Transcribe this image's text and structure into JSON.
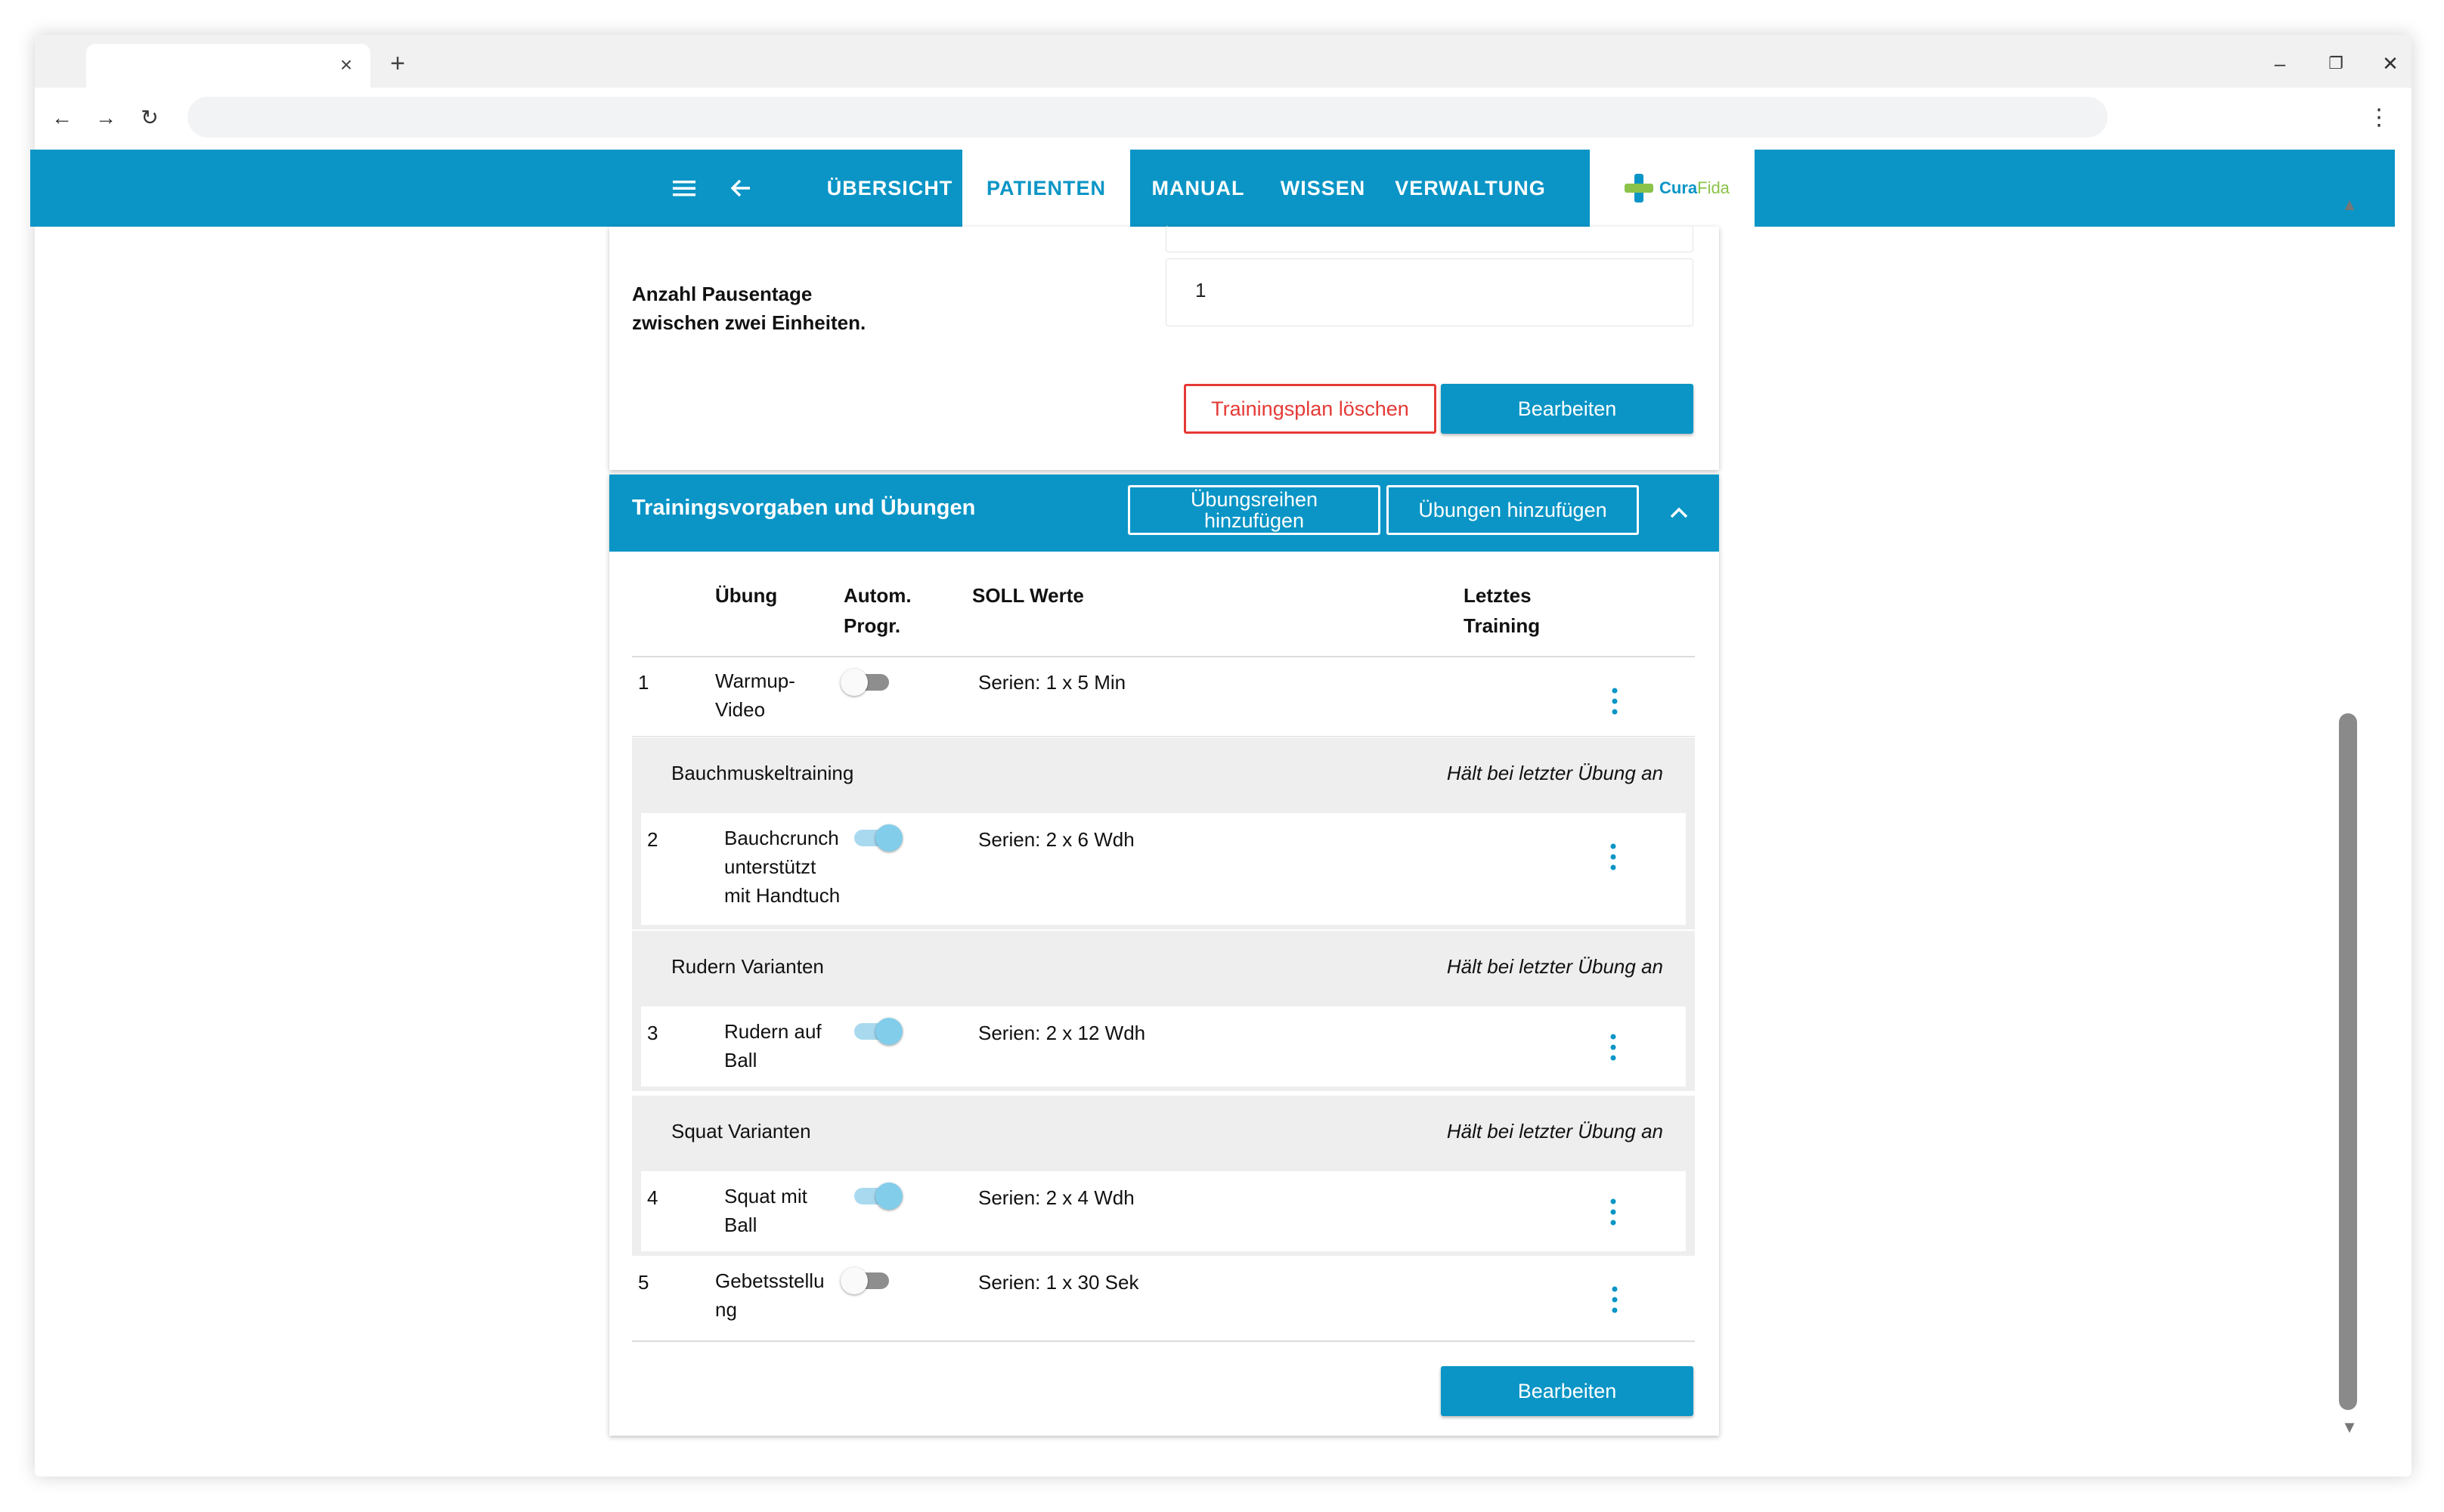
{
  "browser": {
    "tab_close": "×",
    "new_tab": "+",
    "minimize": "–",
    "restore": "❐",
    "close": "✕",
    "back": "←",
    "forward": "→",
    "reload": "↻",
    "menu": "⋮"
  },
  "nav": {
    "items": [
      "ÜBERSICHT",
      "PATIENTEN",
      "MANUAL",
      "WISSEN",
      "VERWALTUNG"
    ],
    "active": "PATIENTEN",
    "logo_main": "Cura",
    "logo_accent": "Fida"
  },
  "plan": {
    "pause_label_line1": "Anzahl Pausentage",
    "pause_label_line2": "zwischen zwei Einheiten.",
    "pause_value": "1",
    "delete_button": "Trainingsplan löschen",
    "edit_button": "Bearbeiten"
  },
  "exercises": {
    "title": "Trainingsvorgaben und Übungen",
    "add_series_button": "Übungsreihen hinzufügen",
    "add_exercises_button": "Übungen hinzufügen",
    "columns": {
      "exercise": "Übung",
      "auto_prog_line1": "Autom.",
      "auto_prog_line2": "Progr.",
      "soll": "SOLL Werte",
      "last_line1": "Letztes",
      "last_line2": "Training"
    },
    "rows": [
      {
        "num": "1",
        "name_line1": "Warmup-",
        "name_line2": "Video",
        "soll": "Serien: 1 x 5 Min",
        "auto": false
      },
      {
        "num": "2",
        "name_line1": "Bauchcrunch",
        "name_line2": "unterstützt",
        "name_line3": "mit Handtuch",
        "soll": "Serien: 2 x 6 Wdh",
        "auto": true
      },
      {
        "num": "3",
        "name_line1": "Rudern auf",
        "name_line2": "Ball",
        "soll": "Serien: 2 x 12 Wdh",
        "auto": true
      },
      {
        "num": "4",
        "name_line1": "Squat mit",
        "name_line2": "Ball",
        "soll": "Serien: 2 x 4 Wdh",
        "auto": true
      },
      {
        "num": "5",
        "name_line1": "Gebetsstellu",
        "name_line2": "ng",
        "soll": "Serien: 1 x 30 Sek",
        "auto": false
      }
    ],
    "groups": [
      {
        "title": "Bauchmuskeltraining",
        "note": "Hält bei letzter Übung an"
      },
      {
        "title": "Rudern Varianten",
        "note": "Hält bei letzter Übung an"
      },
      {
        "title": "Squat Varianten",
        "note": "Hält bei letzter Übung an"
      }
    ],
    "edit_button": "Bearbeiten"
  },
  "colors": {
    "primary": "#0a95c6",
    "danger": "#e53935",
    "toggle_on": "#82cdea",
    "group_bg": "#eeeeee"
  }
}
